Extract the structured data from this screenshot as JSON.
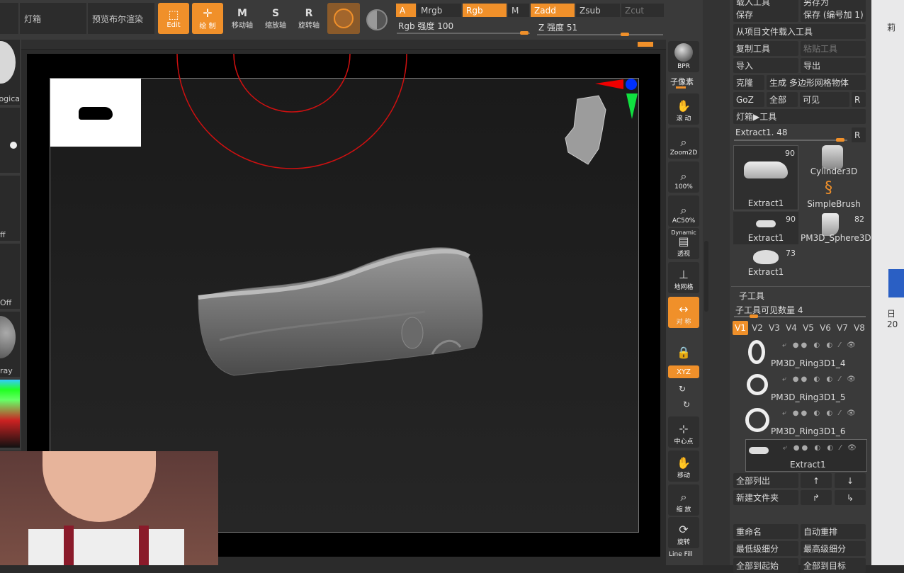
{
  "top": {
    "lightbox": "灯箱",
    "preview_bool": "预览布尔渲染",
    "edit": "Edit",
    "draw": "绘 制",
    "move": "移动轴",
    "scale": "缩放轴",
    "rotate": "旋转轴",
    "mode_a": "A",
    "mrgb": "Mrgb",
    "rgb": "Rgb",
    "m": "M",
    "zadd": "Zadd",
    "zsub": "Zsub",
    "zcut": "Zcut",
    "rgb_intensity": "Rgb 强度 100",
    "z_intensity": "Z 强度 51"
  },
  "left": {
    "logical_frag": "ogica",
    "off1": "ff",
    "off2": "Off",
    "gray": "ray"
  },
  "shelf": {
    "bpr": "BPR",
    "subpixel": "子像素",
    "scroll": "滚 动",
    "zoom2d": "Zoom2D",
    "p100": "100%",
    "ac50": "AC50%",
    "dynamic": "Dynamic",
    "persp": "透视",
    "floor": "地网格",
    "sym": "对 称",
    "xyz": "XYZ",
    "center": "中心点",
    "move": "移动",
    "zoom": "缩 放",
    "rotate": "旋转",
    "linefill": "Line Fill"
  },
  "panel": {
    "load_tool": "载入工具",
    "save_as": "另存为",
    "save": "保存",
    "save_num": "保存 (编号加 1)",
    "load_from_project": "从项目文件载入工具",
    "copy_tool": "复制工具",
    "paste_tool": "粘贴工具",
    "import": "导入",
    "export": "导出",
    "clone": "克隆",
    "make_polymesh": "生成 多边形网格物体",
    "goz": "GoZ",
    "all": "全部",
    "visible": "可见",
    "r": "R",
    "lightbox_tool": "灯箱▶工具",
    "current_tool": "Extract1. 48",
    "tools": [
      {
        "name": "Extract1",
        "count": "90"
      },
      {
        "name": "Cylinder3D",
        "count": ""
      },
      {
        "name": "SimpleBrush",
        "count": ""
      },
      {
        "name": "Extract1",
        "count": "90"
      },
      {
        "name": "PM3D_Sphere3D",
        "count": "82"
      },
      {
        "name": "Extract1",
        "count": "73"
      }
    ],
    "subtool_title": "子工具",
    "subtool_visible": "子工具可见数量 4",
    "vtabs": [
      "V1",
      "V2",
      "V3",
      "V4",
      "V5",
      "V6",
      "V7",
      "V8"
    ],
    "subtools": [
      "PM3D_Ring3D1_4",
      "PM3D_Ring3D1_5",
      "PM3D_Ring3D1_6",
      "Extract1"
    ],
    "list_all": "全部列出",
    "new_folder": "新建文件夹",
    "rename": "重命名",
    "auto_reorder": "自动重排",
    "lowest_sub": "最低级细分",
    "highest_sub": "最高级细分",
    "all_to_start": "全部到起始",
    "all_to_target": "全部到目标"
  },
  "desktop": {
    "frag1": "莉",
    "frag2": "日 20"
  },
  "colors": {
    "accent": "#f0902a",
    "panel": "#3a3a3a",
    "button": "#2f2f2f"
  }
}
